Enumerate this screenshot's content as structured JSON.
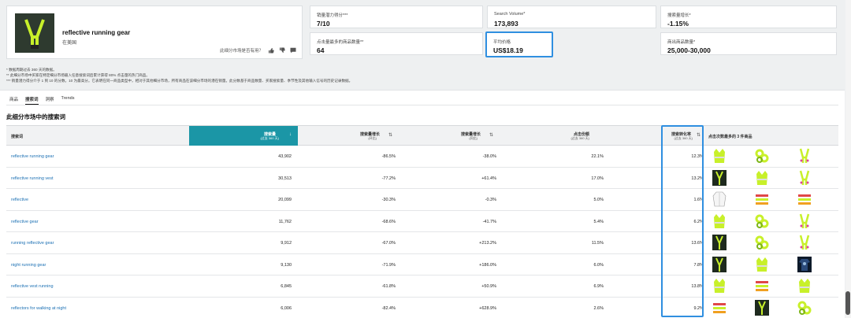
{
  "product": {
    "title": "reflective running gear",
    "market": "在美国",
    "feedback_prompt": "此细分市场是否有用？"
  },
  "metrics": [
    {
      "label": "销量潜力得分***",
      "value": "7/10"
    },
    {
      "label": "Search Volume*",
      "value": "173,893"
    },
    {
      "label": "搜索量增长*",
      "value": "-1.15%"
    },
    {
      "label": "点击量最多的商品数量**",
      "value": "64"
    },
    {
      "label": "平均价格",
      "value": "US$18.19"
    },
    {
      "label": "商出商品数量*",
      "value": "25,000-30,000"
    }
  ],
  "notes": [
    "* 数据周期过去 360 天的数据。",
    "** 此细分市场中买家在特定细分市场输入任意搜索词后累计获得 80% 点击量的热门商品。",
    "*** 销量潜力得分介于 1 到 10 的分数，10 为最高分。它表明在同一商品类型中，相对于其他细分市场，所有商品在该细分市场的潜在销量。此分数基于商品数量、买家搜索量、季节性及其他输入信号的历史记录数据。"
  ],
  "tabs": [
    "商品",
    "搜索词",
    "洞察",
    "Trends"
  ],
  "section_title": "此细分市场中的搜索词",
  "columns": {
    "term": "搜索词",
    "volume": {
      "title": "搜索量",
      "sub": "(过去 360 天)"
    },
    "growth_yoy": {
      "title": "搜索量增长",
      "sub": "(环比)"
    },
    "growth_mom": {
      "title": "搜索量增长",
      "sub": "(同比)"
    },
    "click_share": {
      "title": "点击份额",
      "sub": "(过去 360 天)"
    },
    "conversion": {
      "title": "搜索转化率",
      "sub": "(过去 360 天)"
    },
    "top_products": "点击次数最多的 3 件商品"
  },
  "rows": [
    {
      "term": "reflective running gear",
      "volume": "43,902",
      "g1": "-86.5%",
      "g2": "-38.0%",
      "click": "22.1%",
      "conv": "12.3%"
    },
    {
      "term": "reflective running vest",
      "volume": "30,513",
      "g1": "-77.2%",
      "g2": "+61.4%",
      "click": "17.0%",
      "conv": "13.2%"
    },
    {
      "term": "reflective",
      "volume": "20,099",
      "g1": "-30.3%",
      "g2": "-0.3%",
      "click": "5.0%",
      "conv": "1.6%"
    },
    {
      "term": "reflective gear",
      "volume": "11,762",
      "g1": "-68.6%",
      "g2": "-41.7%",
      "click": "5.4%",
      "conv": "6.2%"
    },
    {
      "term": "running reflective gear",
      "volume": "9,912",
      "g1": "-67.0%",
      "g2": "+213.2%",
      "click": "11.5%",
      "conv": "13.6%"
    },
    {
      "term": "night running gear",
      "volume": "9,130",
      "g1": "-71.9%",
      "g2": "+186.0%",
      "click": "6.0%",
      "conv": "7.8%"
    },
    {
      "term": "reflective vest running",
      "volume": "6,845",
      "g1": "-61.8%",
      "g2": "+50.9%",
      "click": "6.9%",
      "conv": "13.8%"
    },
    {
      "term": "reflectors for walking at night",
      "volume": "6,006",
      "g1": "-82.4%",
      "g2": "+628.9%",
      "click": "2.6%",
      "conv": "9.2%"
    }
  ],
  "colors": {
    "accent": "#1b96a6",
    "highlight": "#2f8fe0",
    "link": "#1a6fb3",
    "neon": "#c8f02a"
  }
}
